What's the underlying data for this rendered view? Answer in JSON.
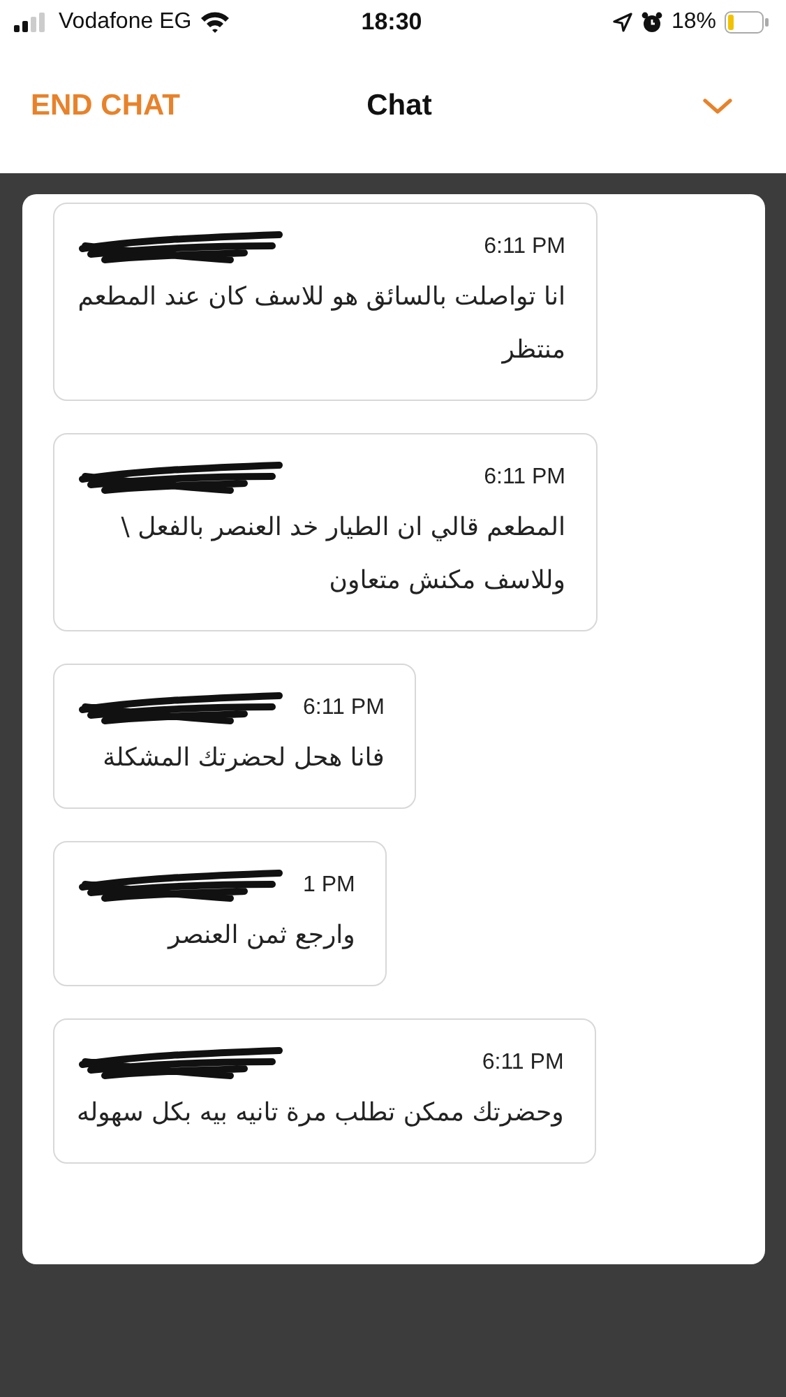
{
  "status_bar": {
    "carrier": "Vodafone EG",
    "time": "18:30",
    "battery": "18%"
  },
  "header": {
    "end_button": "END CHAT",
    "title": "Chat"
  },
  "messages": [
    {
      "time": "6:11 PM",
      "text": "انا تواصلت بالسائق هو للاسف كان عند المطعم منتظر"
    },
    {
      "time": "6:11 PM",
      "text": "المطعم قالي ان الطيار خد العنصر بالفعل \\ وللاسف مكنش متعاون"
    },
    {
      "time": "6:11 PM",
      "text": "فانا هحل لحضرتك المشكلة"
    },
    {
      "time": "1 PM",
      "text": "وارجع ثمن العنصر"
    },
    {
      "time": "6:11 PM",
      "text": "وحضرتك ممكن تطلب مرة تانيه بيه بكل سهوله"
    }
  ]
}
